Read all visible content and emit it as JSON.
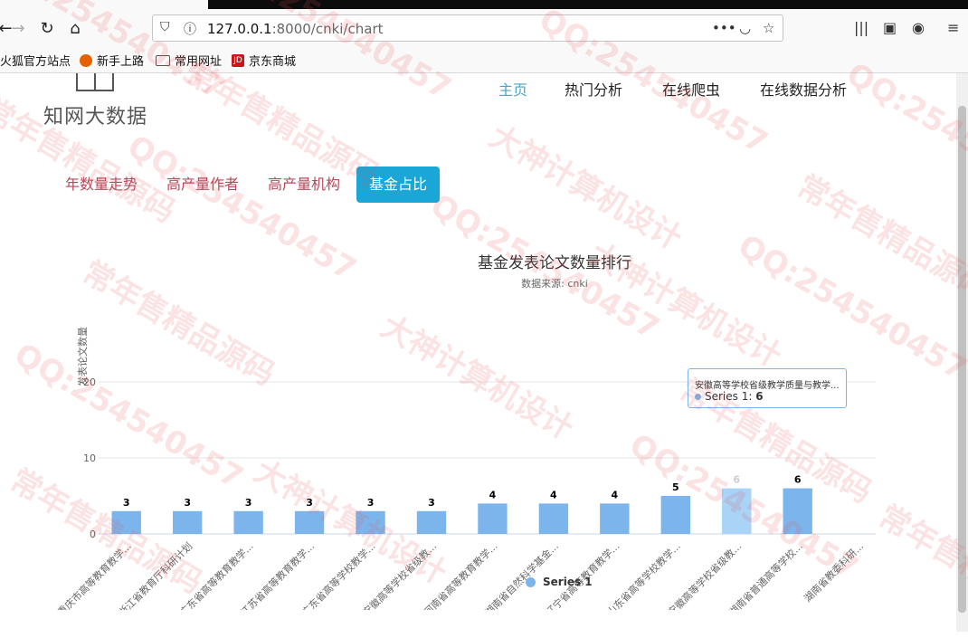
{
  "browser": {
    "url_host": "127.0.0.1",
    "url_path": ":8000/cnki/chart",
    "bookmarks": [
      "火狐官方站点",
      "新手上路",
      "常用网址",
      "京东商城"
    ]
  },
  "site": {
    "logo_text": "知网大数据",
    "nav": [
      "主页",
      "热门分析",
      "在线爬虫",
      "在线数据分析"
    ],
    "tabs": [
      "年数量走势",
      "高产量作者",
      "高产量机构",
      "基金占比"
    ]
  },
  "chart_data": {
    "type": "bar",
    "title": "基金发表论文数量排行",
    "subtitle": "数据来源: cnki",
    "ylabel": "发表论文数量",
    "ylim": [
      0,
      20
    ],
    "yticks": [
      0,
      10,
      20
    ],
    "categories": [
      "重庆市高等教育教学...",
      "浙江省教育厅科研计划",
      "广东省高等教育教学...",
      "江苏省高等教育教学...",
      "广东省高等学校教学...",
      "安徽高等学校省级教...",
      "河南省高等教育教学...",
      "湖南省自然科学基金...",
      "辽宁省高等教育教学...",
      "山东省高等学校教学...",
      "安徽高等学校省级教...",
      "湖南省普通高等学校...",
      "湖南省教委科研..."
    ],
    "series": [
      {
        "name": "Series 1",
        "values": [
          3,
          3,
          3,
          3,
          3,
          3,
          4,
          4,
          4,
          5,
          6,
          6
        ]
      }
    ],
    "color": "#7cb5ec",
    "hover_color": "#a9d3f7"
  },
  "tooltip": {
    "title": "安徽高等学校省级教学质量与教学...",
    "series_label": "Series 1: ",
    "value": "6"
  },
  "watermarks": [
    "QQ:254540457",
    "常年售精品源码",
    "大神计算机设计"
  ]
}
